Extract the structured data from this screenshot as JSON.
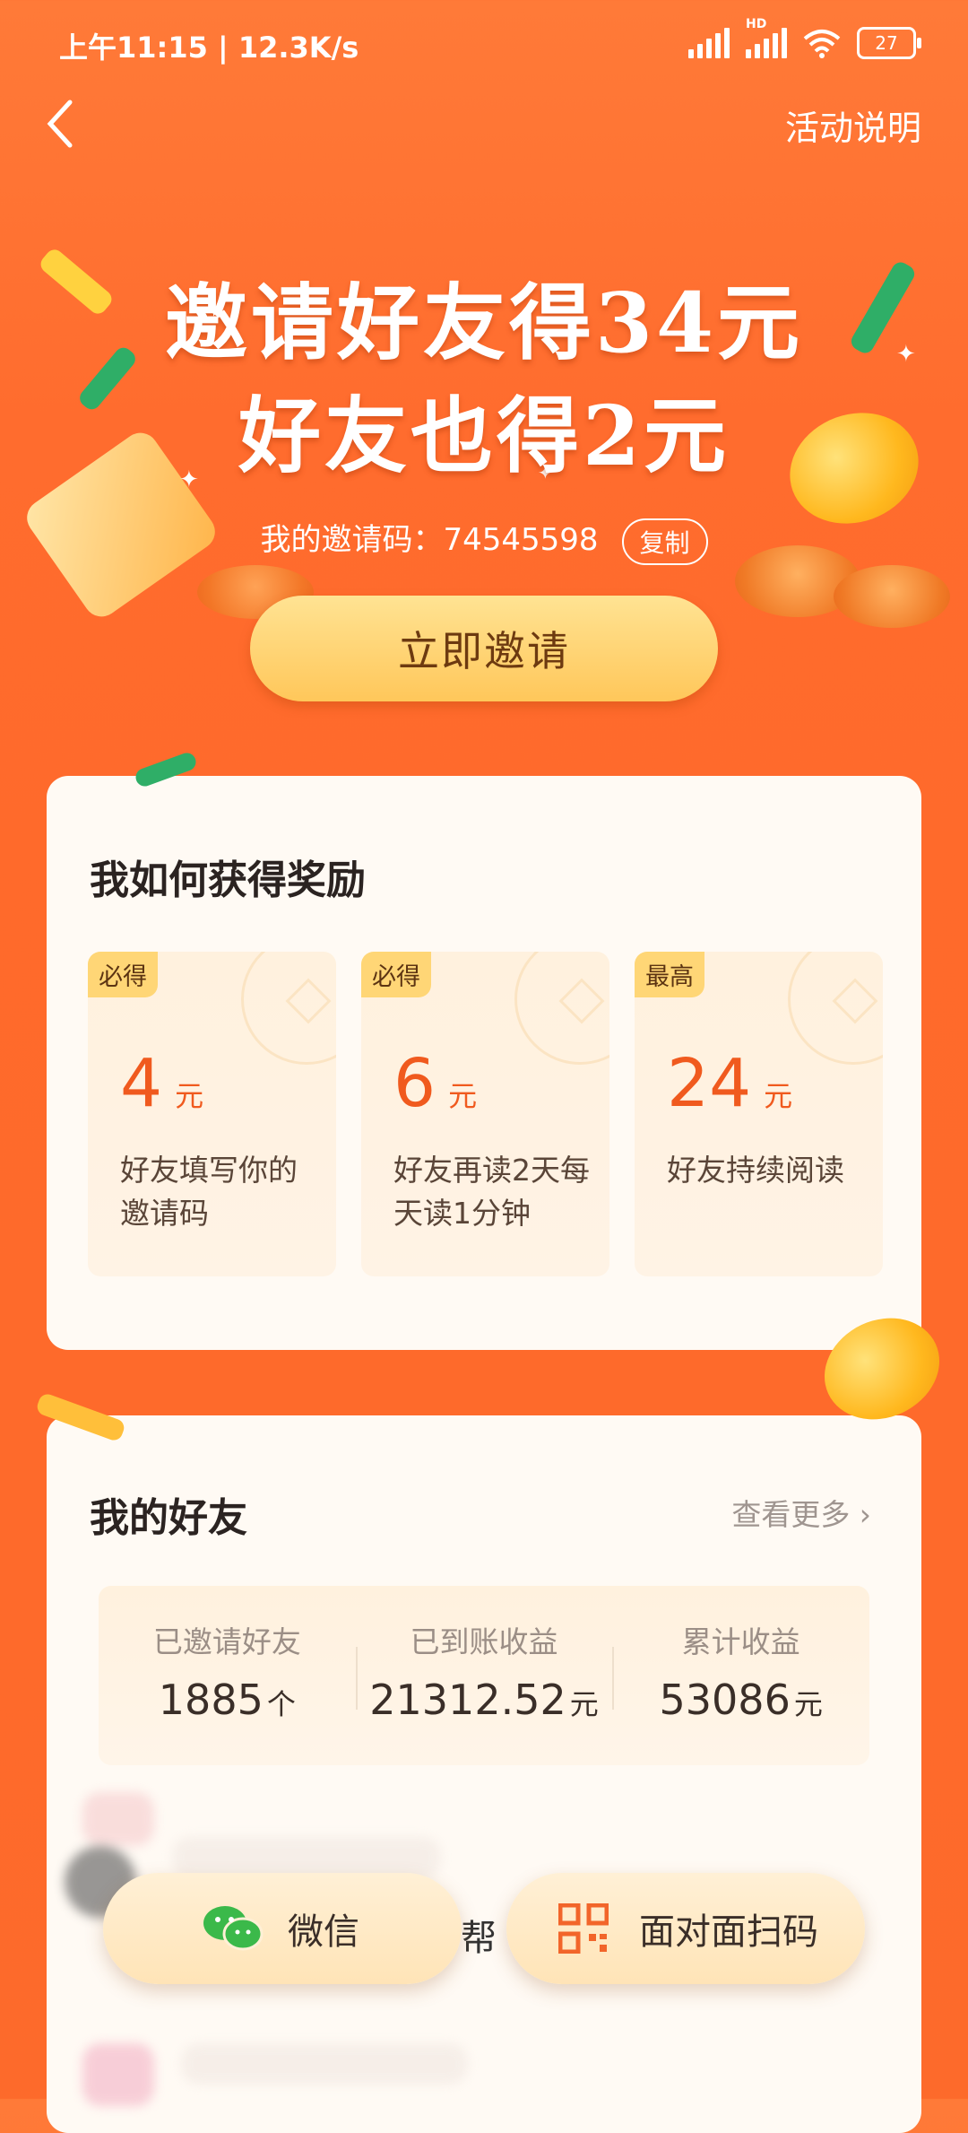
{
  "status_bar": {
    "time_speed": "上午11:15 | 12.3K/s",
    "hd": "HD",
    "battery": "27"
  },
  "nav": {
    "back_icon": "chevron-left-icon",
    "rules_label": "活动说明"
  },
  "hero": {
    "headline_1": "邀请好友得34元",
    "headline_2": "好友也得2元",
    "invite_code_label": "我的邀请码：74545598",
    "copy_label": "复制",
    "invite_button": "立即邀请"
  },
  "how_to": {
    "title": "我如何获得奖励",
    "rewards": [
      {
        "tag": "必得",
        "amount": "4",
        "unit": "元",
        "desc": "好友填写你的邀请码"
      },
      {
        "tag": "必得",
        "amount": "6",
        "unit": "元",
        "desc": "好友再读2天每天读1分钟"
      },
      {
        "tag": "最高",
        "amount": "24",
        "unit": "元",
        "desc": "好友持续阅读"
      }
    ]
  },
  "friends": {
    "title": "我的好友",
    "more_label": "查看更多 ›",
    "stats": [
      {
        "label": "已邀请好友",
        "value": "1885",
        "unit": "个"
      },
      {
        "label": "已到账收益",
        "value": "21312.52",
        "unit": "元"
      },
      {
        "label": "累计收益",
        "value": "53086",
        "unit": "元"
      }
    ],
    "partial_text": "帮"
  },
  "share_bar": {
    "wechat_label": "微信",
    "wechat_icon": "wechat-icon",
    "qr_label": "面对面扫码",
    "qr_icon": "qr-code-icon"
  },
  "colors": {
    "background": "#ff6c2e",
    "accent": "#f05a1e",
    "button": "#ffc75a"
  }
}
